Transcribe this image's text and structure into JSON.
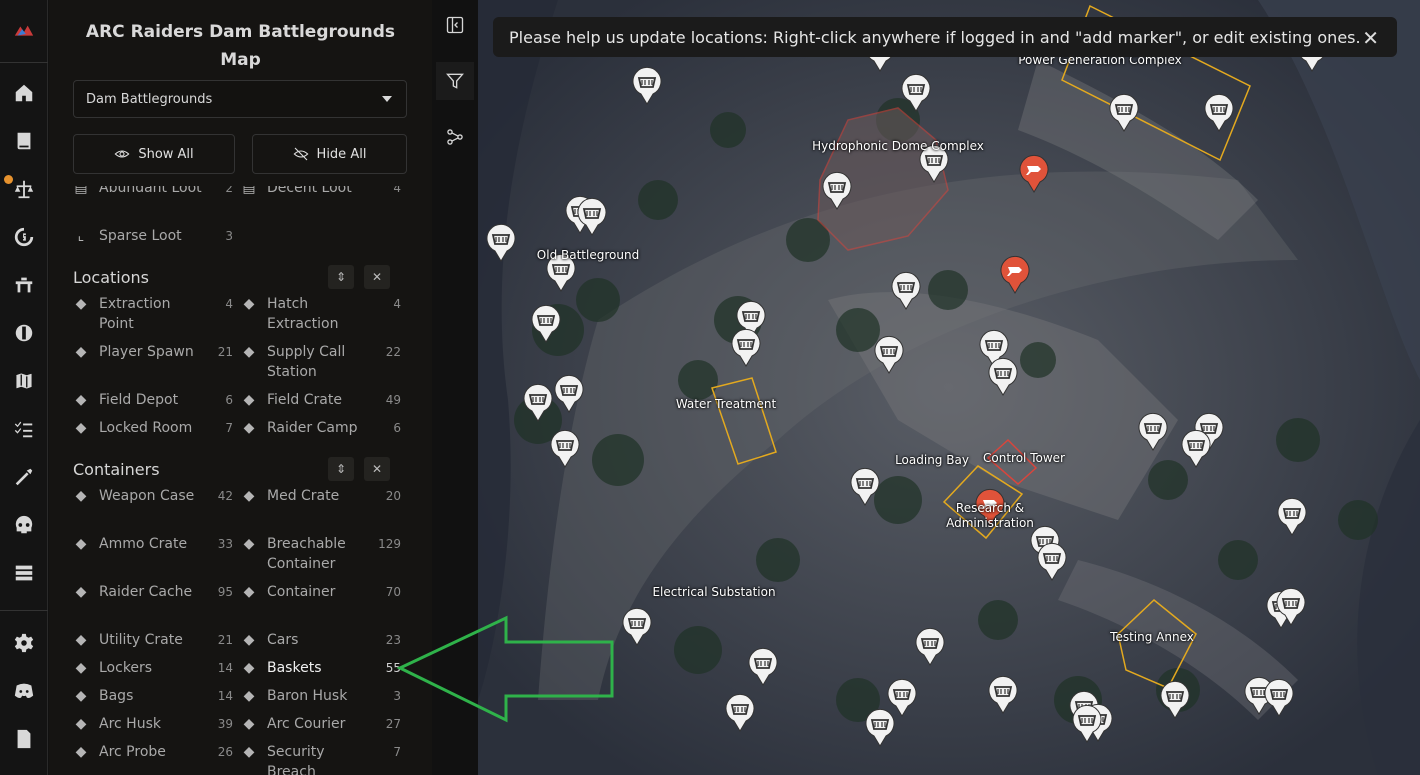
{
  "app": {
    "title": "ARC Raiders Dam Battlegrounds Map"
  },
  "map_select": {
    "value": "Dam Battlegrounds"
  },
  "buttons": {
    "show_all": "Show All",
    "hide_all": "Hide All"
  },
  "partial_items": [
    {
      "label": "Abundant Loot",
      "count": "2"
    },
    {
      "label": "Decent Loot",
      "count": "4"
    },
    {
      "label": "Sparse Loot",
      "count": "3"
    }
  ],
  "sections": {
    "locations": {
      "title": "Locations",
      "items": [
        {
          "label": "Extraction Point",
          "count": "4",
          "icon": "extraction-icon"
        },
        {
          "label": "Hatch Extraction",
          "count": "4",
          "icon": "hatch-icon"
        },
        {
          "label": "Player Spawn",
          "count": "21",
          "icon": "spawn-icon"
        },
        {
          "label": "Supply Call Station",
          "count": "22",
          "icon": "supply-call-icon"
        },
        {
          "label": "Field Depot",
          "count": "6",
          "icon": "depot-icon"
        },
        {
          "label": "Field Crate",
          "count": "49",
          "icon": "crate-icon"
        },
        {
          "label": "Locked Room",
          "count": "7",
          "icon": "locked-room-icon"
        },
        {
          "label": "Raider Camp",
          "count": "6",
          "icon": "camp-icon"
        }
      ]
    },
    "containers": {
      "title": "Containers",
      "items": [
        {
          "label": "Weapon Case",
          "count": "42",
          "icon": "weapon-case-icon"
        },
        {
          "label": "Med Crate",
          "count": "20",
          "icon": "med-crate-icon"
        },
        {
          "label": "Ammo Crate",
          "count": "33",
          "icon": "ammo-crate-icon"
        },
        {
          "label": "Breachable Container",
          "count": "129",
          "icon": "breachable-icon"
        },
        {
          "label": "Raider Cache",
          "count": "95",
          "icon": "raider-cache-icon"
        },
        {
          "label": "Container",
          "count": "70",
          "icon": "container-icon"
        },
        {
          "label": "Utility Crate",
          "count": "21",
          "icon": "utility-crate-icon"
        },
        {
          "label": "Cars",
          "count": "23",
          "icon": "car-icon"
        },
        {
          "label": "Lockers",
          "count": "14",
          "icon": "locker-icon"
        },
        {
          "label": "Baskets",
          "count": "55",
          "icon": "basket-icon"
        },
        {
          "label": "Bags",
          "count": "14",
          "icon": "bag-icon"
        },
        {
          "label": "Baron Husk",
          "count": "3",
          "icon": "baron-husk-icon"
        },
        {
          "label": "Arc Husk",
          "count": "39",
          "icon": "arc-husk-icon"
        },
        {
          "label": "Arc Courier",
          "count": "27",
          "icon": "arc-courier-icon"
        },
        {
          "label": "Arc Probe",
          "count": "26",
          "icon": "arc-probe-icon"
        },
        {
          "label": "Security Breach",
          "count": "7",
          "icon": "security-breach-icon"
        }
      ]
    }
  },
  "banner": {
    "text": "Please help us update locations: Right-click anywhere if logged in and \"add marker\", or edit existing ones.",
    "close": "✕"
  },
  "map_labels": {
    "power": "Power Generation Complex",
    "hydro": "Hydrophonic Dome Complex",
    "old_bg": "Old Battleground",
    "water": "Water Treatment",
    "loading": "Loading Bay",
    "control": "Control Tower",
    "research_1": "Research &",
    "research_2": "Administration",
    "electrical": "Electrical Substation",
    "testing": "Testing Annex"
  },
  "colors": {
    "accent_orange": "#e6922e",
    "zone_yellow": "#e3a91f",
    "zone_red": "#d9453c",
    "marker_red": "#e0533a",
    "arrow_green": "#2fb24a"
  }
}
